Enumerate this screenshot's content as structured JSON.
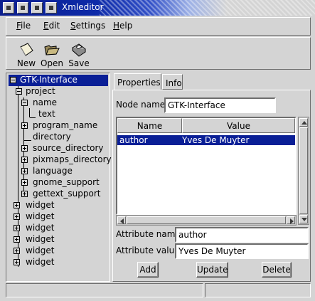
{
  "window": {
    "title": "Xmleditor"
  },
  "menubar": {
    "items": [
      {
        "label": "File",
        "mnemonic": "F",
        "rest": "ile"
      },
      {
        "label": "Edit",
        "mnemonic": "E",
        "rest": "dit"
      },
      {
        "label": "Settings",
        "mnemonic": "S",
        "rest": "ettings"
      },
      {
        "label": "Help",
        "mnemonic": "H",
        "rest": "elp"
      }
    ]
  },
  "toolbar": {
    "new_label": "New",
    "open_label": "Open",
    "save_label": "Save"
  },
  "tree": {
    "nodes": [
      {
        "label": "GTK-Interface",
        "level": 0,
        "expander": "minus",
        "selected": true
      },
      {
        "label": "project",
        "level": 1,
        "expander": "minus"
      },
      {
        "label": "name",
        "level": 2,
        "expander": "minus"
      },
      {
        "label": "text",
        "level": 3,
        "expander": "none"
      },
      {
        "label": "program_name",
        "level": 2,
        "expander": "plus"
      },
      {
        "label": "directory",
        "level": 2,
        "expander": "none"
      },
      {
        "label": "source_directory",
        "level": 2,
        "expander": "plus"
      },
      {
        "label": "pixmaps_directory",
        "level": 2,
        "expander": "plus"
      },
      {
        "label": "language",
        "level": 2,
        "expander": "plus"
      },
      {
        "label": "gnome_support",
        "level": 2,
        "expander": "plus"
      },
      {
        "label": "gettext_support",
        "level": 2,
        "expander": "plus"
      },
      {
        "label": "widget",
        "level": 1,
        "expander": "plus"
      },
      {
        "label": "widget",
        "level": 1,
        "expander": "plus"
      },
      {
        "label": "widget",
        "level": 1,
        "expander": "plus"
      },
      {
        "label": "widget",
        "level": 1,
        "expander": "plus"
      },
      {
        "label": "widget",
        "level": 1,
        "expander": "plus"
      },
      {
        "label": "widget",
        "level": 1,
        "expander": "plus"
      }
    ]
  },
  "tabs": [
    {
      "label": "Properties",
      "active": true
    },
    {
      "label": "Info",
      "active": false
    }
  ],
  "properties": {
    "node_name_label": "Node name:",
    "node_name_value": "GTK-Interface",
    "columns": [
      "Name",
      "Value"
    ],
    "rows": [
      {
        "name": "author",
        "value": "Yves De Muyter",
        "selected": true
      }
    ],
    "attribute_name_label": "Attribute name:",
    "attribute_name_value": "author",
    "attribute_value_label": "Attribute value:",
    "attribute_value_value": "Yves De Muyter",
    "add_label": "Add",
    "update_label": "Update",
    "delete_label": "Delete"
  },
  "colors": {
    "selection": "#0a1f96",
    "title_gradient_start": "#0c1f8f",
    "background": "#d4d4d4"
  }
}
